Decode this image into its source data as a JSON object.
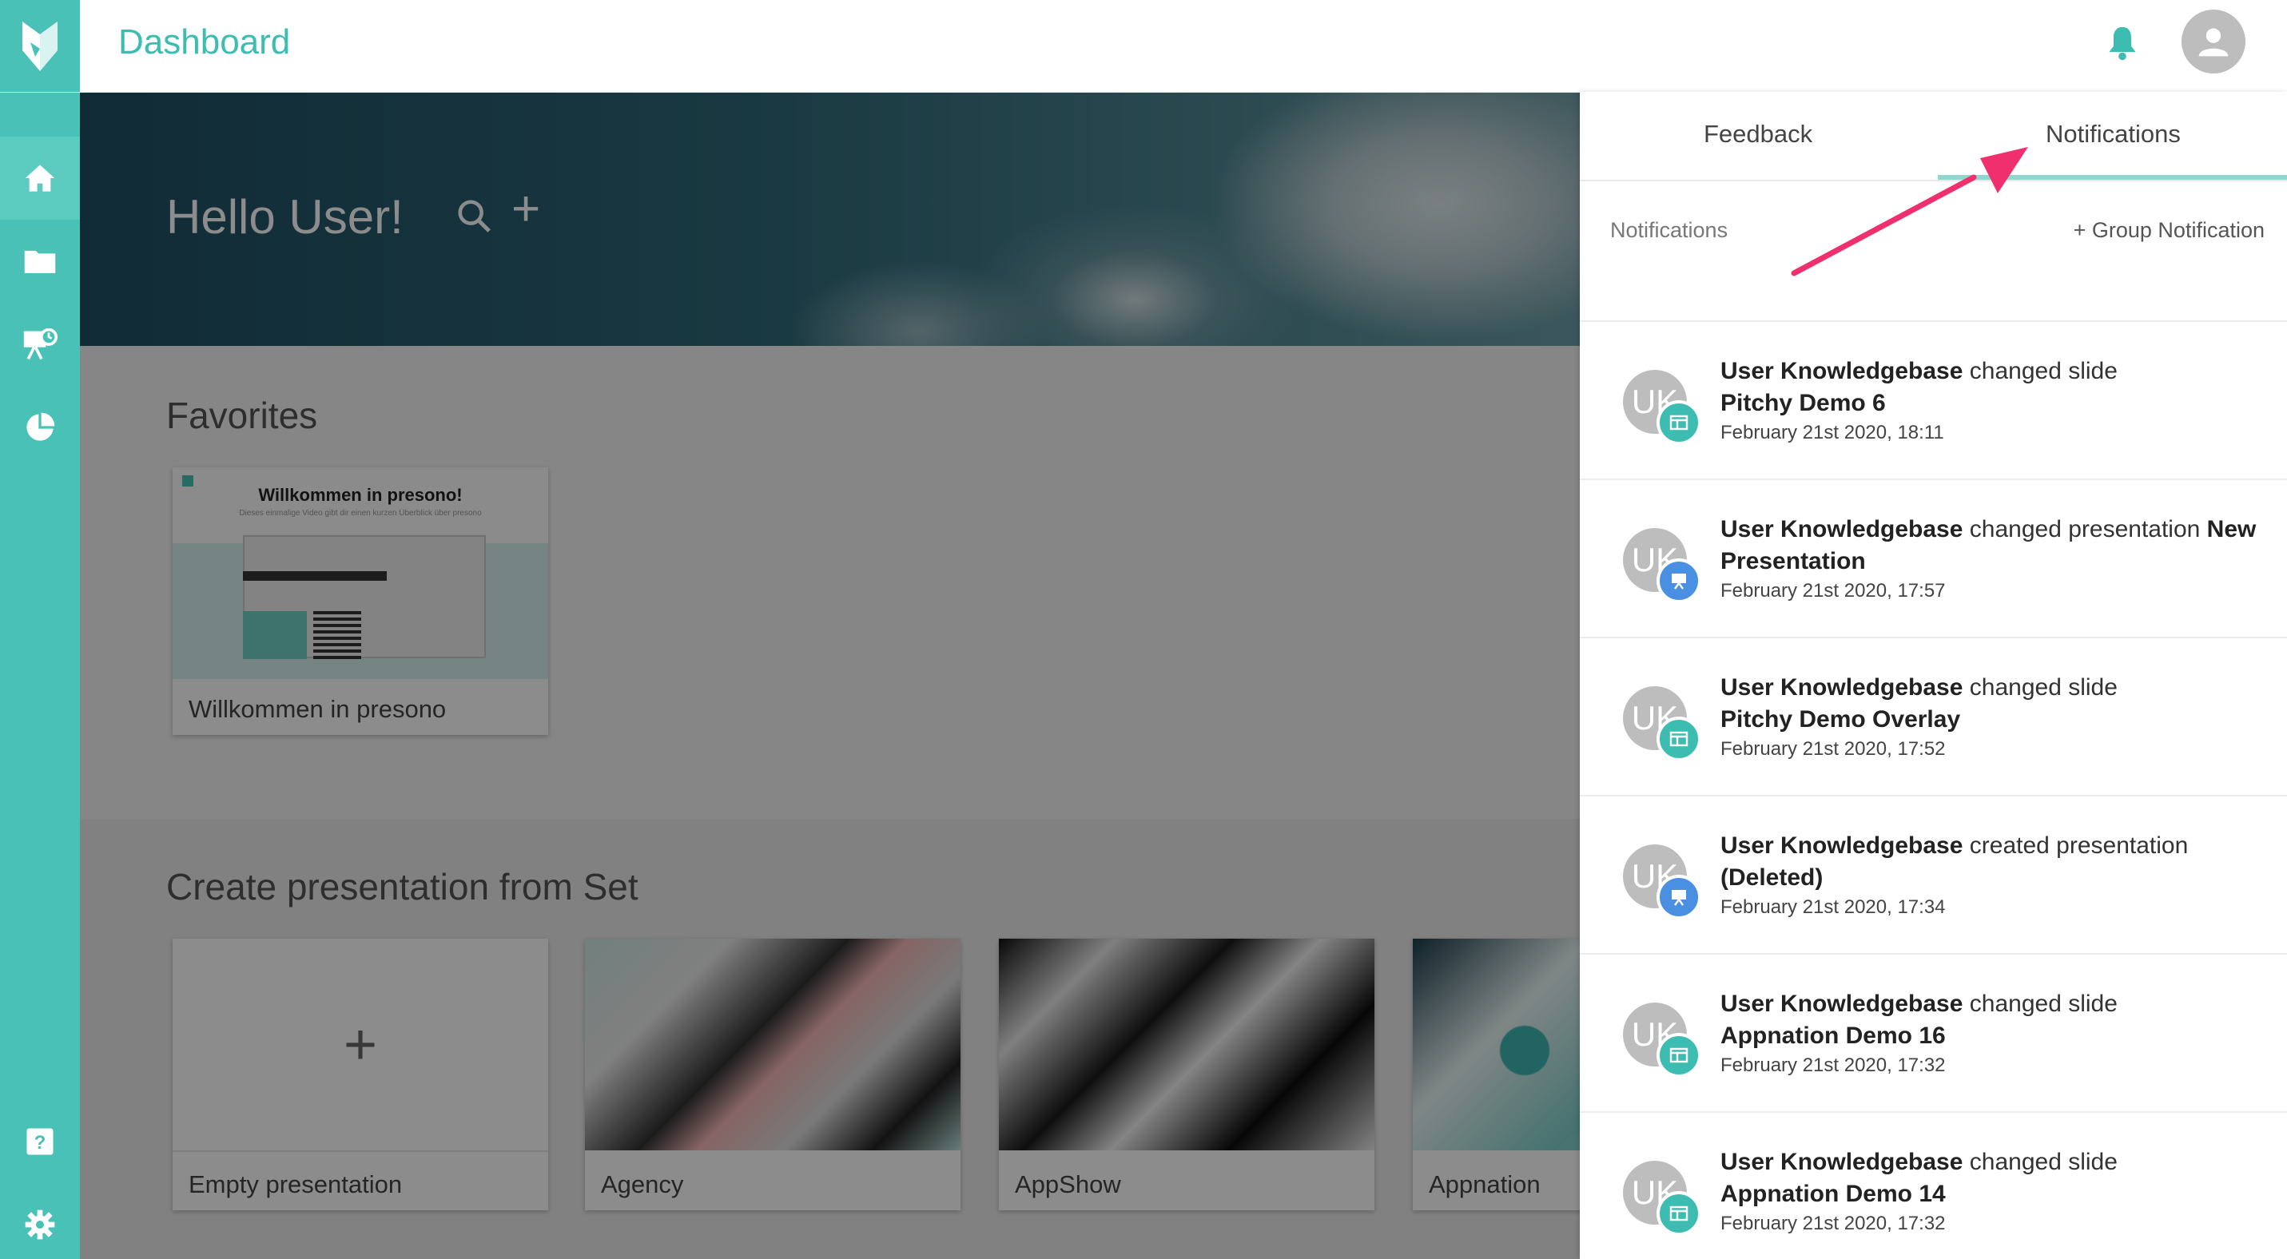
{
  "header": {
    "title": "Dashboard"
  },
  "hero": {
    "greeting": "Hello User!"
  },
  "favorites": {
    "title": "Favorites",
    "cards": [
      {
        "label": "Willkommen in presono",
        "thumb_title": "Willkommen in presono!",
        "thumb_subtitle": "Dieses einmalige Video gibt dir einen kurzen Überblick über presono"
      }
    ]
  },
  "sets": {
    "title": "Create presentation from Set",
    "cards": [
      {
        "label": "Empty presentation"
      },
      {
        "label": "Agency"
      },
      {
        "label": "AppShow"
      },
      {
        "label": "Appnation"
      }
    ]
  },
  "panel": {
    "tabs": [
      {
        "label": "Feedback"
      },
      {
        "label": "Notifications"
      }
    ],
    "active_tab": "Notifications",
    "sub_title": "Notifications",
    "group_button": "+ Group Notification",
    "notifications": [
      {
        "initials": "UK",
        "user": "User Knowledgebase",
        "action": " changed slide",
        "target": "Pitchy Demo 6",
        "date": "February 21st 2020, 18:11",
        "type": "slide"
      },
      {
        "initials": "UK",
        "user": "User Knowledgebase",
        "action": " changed presentation ",
        "target": "New Presentation",
        "date": "February 21st 2020, 17:57",
        "type": "presentation"
      },
      {
        "initials": "UK",
        "user": "User Knowledgebase",
        "action": " changed slide",
        "target": "Pitchy Demo Overlay",
        "date": "February 21st 2020, 17:52",
        "type": "slide"
      },
      {
        "initials": "UK",
        "user": "User Knowledgebase",
        "action": " created presentation ",
        "target": "(Deleted)",
        "date": "February 21st 2020, 17:34",
        "type": "presentation"
      },
      {
        "initials": "UK",
        "user": "User Knowledgebase",
        "action": " changed slide",
        "target": "Appnation Demo 16",
        "date": "February 21st 2020, 17:32",
        "type": "slide"
      },
      {
        "initials": "UK",
        "user": "User Knowledgebase",
        "action": " changed slide",
        "target": "Appnation Demo 14",
        "date": "February 21st 2020, 17:32",
        "type": "slide"
      }
    ]
  },
  "colors": {
    "accent": "#4ac1b6",
    "title": "#3dbdb1",
    "arrow": "#f0306e",
    "badge_slide": "#3dbdb1",
    "badge_presentation": "#4a90e2"
  },
  "icons": {
    "logo": "fox-logo-icon",
    "notifications": "bell-icon",
    "user": "user-avatar-icon"
  }
}
